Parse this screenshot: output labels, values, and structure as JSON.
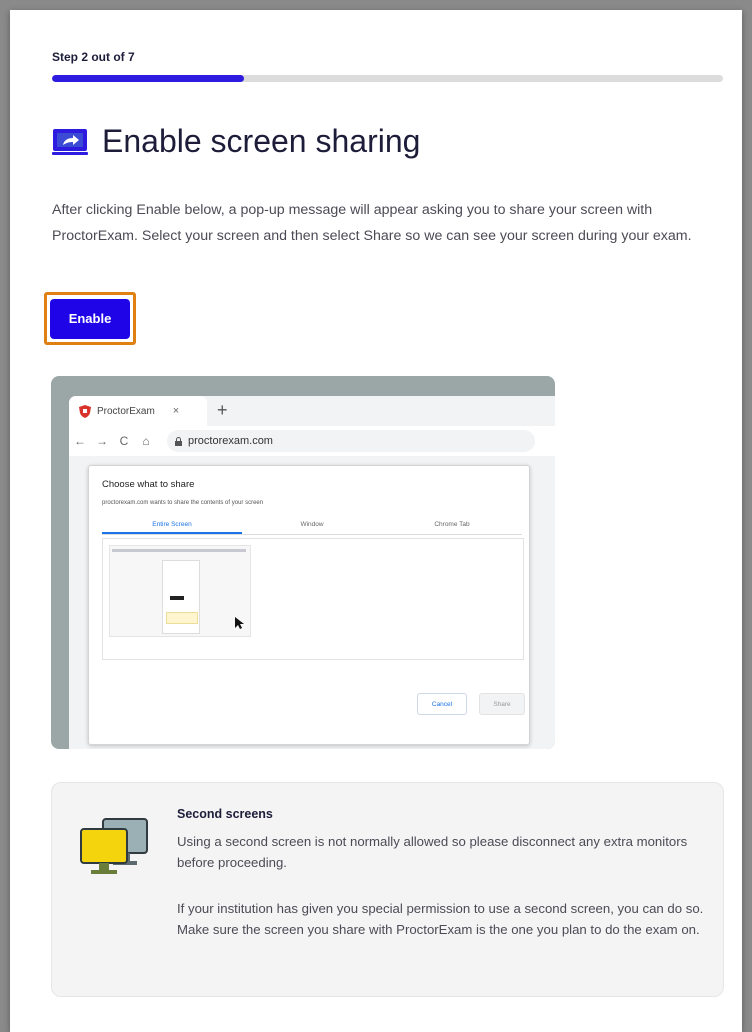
{
  "step": {
    "label": "Step 2 out of 7",
    "progress_fraction": 0.2857
  },
  "header": {
    "title": "Enable screen sharing",
    "icon": "screen-share-icon",
    "icon_color": "#2d1be0"
  },
  "intro": "After clicking Enable below, a pop-up message will appear asking you to share your screen with ProctorExam. Select your screen and then select Share so we can see your screen during your exam.",
  "enable_button": {
    "label": "Enable",
    "bg_color": "#1f04e8",
    "highlight_color": "#e07f12"
  },
  "illustration": {
    "tab_title": "ProctorExam",
    "tab_close": "×",
    "new_tab": "+",
    "nav": {
      "back": "←",
      "forward": "→",
      "reload": "C",
      "home": "⌂"
    },
    "url": "proctorexam.com",
    "dialog": {
      "title": "Choose what to share",
      "subtitle": "proctorexam.com wants to share the contents of your screen",
      "tabs": [
        "Entire Screen",
        "Window",
        "Chrome Tab"
      ],
      "cancel": "Cancel",
      "share": "Share"
    }
  },
  "second_screens": {
    "title": "Second screens",
    "p1": "Using a second screen is not normally allowed so please disconnect any extra monitors before proceeding.",
    "p2": "If your institution has given you special permission to use a second screen, you can do so. Make sure the screen you share with ProctorExam is the one you plan to do the exam on.",
    "icon": "two-monitors-icon"
  }
}
